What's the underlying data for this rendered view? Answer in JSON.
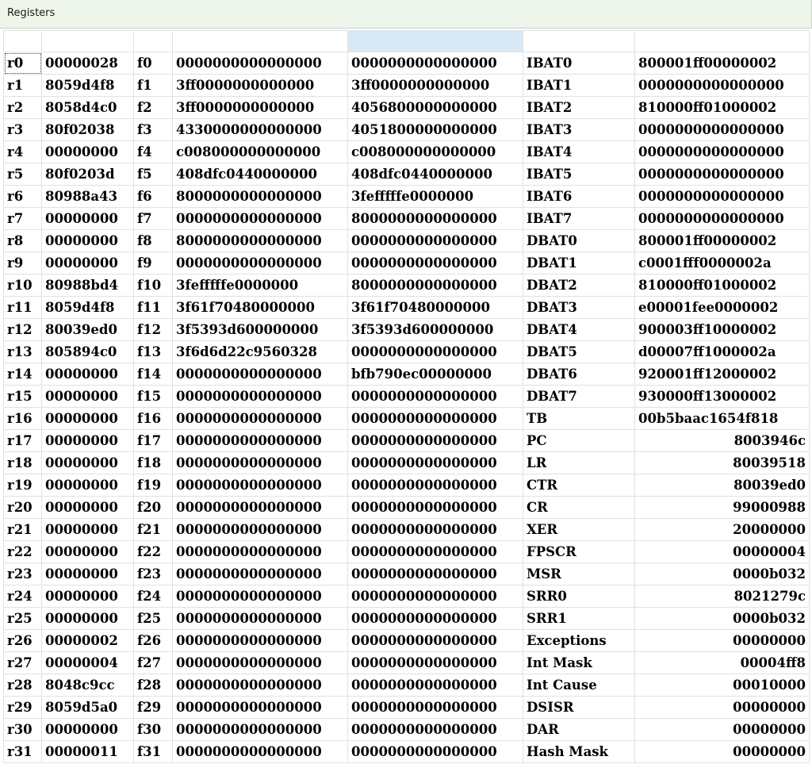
{
  "window": {
    "title": "Registers"
  },
  "gpr": [
    {
      "name": "r0",
      "value": "00000028"
    },
    {
      "name": "r1",
      "value": "8059d4f8"
    },
    {
      "name": "r2",
      "value": "8058d4c0"
    },
    {
      "name": "r3",
      "value": "80f02038"
    },
    {
      "name": "r4",
      "value": "00000000"
    },
    {
      "name": "r5",
      "value": "80f0203d"
    },
    {
      "name": "r6",
      "value": "80988a43"
    },
    {
      "name": "r7",
      "value": "00000000"
    },
    {
      "name": "r8",
      "value": "00000000"
    },
    {
      "name": "r9",
      "value": "00000000"
    },
    {
      "name": "r10",
      "value": "80988bd4"
    },
    {
      "name": "r11",
      "value": "8059d4f8"
    },
    {
      "name": "r12",
      "value": "80039ed0"
    },
    {
      "name": "r13",
      "value": "805894c0"
    },
    {
      "name": "r14",
      "value": "00000000"
    },
    {
      "name": "r15",
      "value": "00000000"
    },
    {
      "name": "r16",
      "value": "00000000"
    },
    {
      "name": "r17",
      "value": "00000000"
    },
    {
      "name": "r18",
      "value": "00000000"
    },
    {
      "name": "r19",
      "value": "00000000"
    },
    {
      "name": "r20",
      "value": "00000000"
    },
    {
      "name": "r21",
      "value": "00000000"
    },
    {
      "name": "r22",
      "value": "00000000"
    },
    {
      "name": "r23",
      "value": "00000000"
    },
    {
      "name": "r24",
      "value": "00000000"
    },
    {
      "name": "r25",
      "value": "00000000"
    },
    {
      "name": "r26",
      "value": "00000002"
    },
    {
      "name": "r27",
      "value": "00000004"
    },
    {
      "name": "r28",
      "value": "8048c9cc"
    },
    {
      "name": "r29",
      "value": "8059d5a0"
    },
    {
      "name": "r30",
      "value": "00000000"
    },
    {
      "name": "r31",
      "value": "00000011"
    }
  ],
  "fpr": [
    {
      "name": "f0",
      "ps0": "0000000000000000",
      "ps1": "0000000000000000"
    },
    {
      "name": "f1",
      "ps0": "3ff0000000000000",
      "ps1": "3ff0000000000000"
    },
    {
      "name": "f2",
      "ps0": "3ff0000000000000",
      "ps1": "4056800000000000"
    },
    {
      "name": "f3",
      "ps0": "4330000000000000",
      "ps1": "4051800000000000"
    },
    {
      "name": "f4",
      "ps0": "c008000000000000",
      "ps1": "c008000000000000"
    },
    {
      "name": "f5",
      "ps0": "408dfc0440000000",
      "ps1": "408dfc0440000000"
    },
    {
      "name": "f6",
      "ps0": "8000000000000000",
      "ps1": "3fefffffe0000000"
    },
    {
      "name": "f7",
      "ps0": "0000000000000000",
      "ps1": "8000000000000000"
    },
    {
      "name": "f8",
      "ps0": "8000000000000000",
      "ps1": "0000000000000000"
    },
    {
      "name": "f9",
      "ps0": "0000000000000000",
      "ps1": "0000000000000000"
    },
    {
      "name": "f10",
      "ps0": "3fefffffe0000000",
      "ps1": "8000000000000000"
    },
    {
      "name": "f11",
      "ps0": "3f61f70480000000",
      "ps1": "3f61f70480000000"
    },
    {
      "name": "f12",
      "ps0": "3f5393d600000000",
      "ps1": "3f5393d600000000"
    },
    {
      "name": "f13",
      "ps0": "3f6d6d22c9560328",
      "ps1": "0000000000000000"
    },
    {
      "name": "f14",
      "ps0": "0000000000000000",
      "ps1": "bfb790ec00000000"
    },
    {
      "name": "f15",
      "ps0": "0000000000000000",
      "ps1": "0000000000000000"
    },
    {
      "name": "f16",
      "ps0": "0000000000000000",
      "ps1": "0000000000000000"
    },
    {
      "name": "f17",
      "ps0": "0000000000000000",
      "ps1": "0000000000000000"
    },
    {
      "name": "f18",
      "ps0": "0000000000000000",
      "ps1": "0000000000000000"
    },
    {
      "name": "f19",
      "ps0": "0000000000000000",
      "ps1": "0000000000000000"
    },
    {
      "name": "f20",
      "ps0": "0000000000000000",
      "ps1": "0000000000000000"
    },
    {
      "name": "f21",
      "ps0": "0000000000000000",
      "ps1": "0000000000000000"
    },
    {
      "name": "f22",
      "ps0": "0000000000000000",
      "ps1": "0000000000000000"
    },
    {
      "name": "f23",
      "ps0": "0000000000000000",
      "ps1": "0000000000000000"
    },
    {
      "name": "f24",
      "ps0": "0000000000000000",
      "ps1": "0000000000000000"
    },
    {
      "name": "f25",
      "ps0": "0000000000000000",
      "ps1": "0000000000000000"
    },
    {
      "name": "f26",
      "ps0": "0000000000000000",
      "ps1": "0000000000000000"
    },
    {
      "name": "f27",
      "ps0": "0000000000000000",
      "ps1": "0000000000000000"
    },
    {
      "name": "f28",
      "ps0": "0000000000000000",
      "ps1": "0000000000000000"
    },
    {
      "name": "f29",
      "ps0": "0000000000000000",
      "ps1": "0000000000000000"
    },
    {
      "name": "f30",
      "ps0": "0000000000000000",
      "ps1": "0000000000000000"
    },
    {
      "name": "f31",
      "ps0": "0000000000000000",
      "ps1": "0000000000000000"
    }
  ],
  "spr": [
    {
      "name": "IBAT0",
      "value": "800001ff00000002"
    },
    {
      "name": "IBAT1",
      "value": "0000000000000000"
    },
    {
      "name": "IBAT2",
      "value": "810000ff01000002"
    },
    {
      "name": "IBAT3",
      "value": "0000000000000000"
    },
    {
      "name": "IBAT4",
      "value": "0000000000000000"
    },
    {
      "name": "IBAT5",
      "value": "0000000000000000"
    },
    {
      "name": "IBAT6",
      "value": "0000000000000000"
    },
    {
      "name": "IBAT7",
      "value": "0000000000000000"
    },
    {
      "name": "DBAT0",
      "value": "800001ff00000002"
    },
    {
      "name": "DBAT1",
      "value": "c0001fff0000002a"
    },
    {
      "name": "DBAT2",
      "value": "810000ff01000002"
    },
    {
      "name": "DBAT3",
      "value": "e00001fee0000002"
    },
    {
      "name": "DBAT4",
      "value": "900003ff10000002"
    },
    {
      "name": "DBAT5",
      "value": "d00007ff1000002a"
    },
    {
      "name": "DBAT6",
      "value": "920001ff12000002"
    },
    {
      "name": "DBAT7",
      "value": "930000ff13000002"
    },
    {
      "name": "TB",
      "value": "00b5baac1654f818"
    },
    {
      "name": "PC",
      "value": "8003946c"
    },
    {
      "name": "LR",
      "value": "80039518"
    },
    {
      "name": "CTR",
      "value": "80039ed0"
    },
    {
      "name": "CR",
      "value": "99000988"
    },
    {
      "name": "XER",
      "value": "20000000"
    },
    {
      "name": "FPSCR",
      "value": "00000004"
    },
    {
      "name": "MSR",
      "value": "0000b032"
    },
    {
      "name": "SRR0",
      "value": "8021279c"
    },
    {
      "name": "SRR1",
      "value": "0000b032"
    },
    {
      "name": "Exceptions",
      "value": "00000000"
    },
    {
      "name": "Int Mask",
      "value": "00004ff8"
    },
    {
      "name": "Int Cause",
      "value": "00010000"
    },
    {
      "name": "DSISR",
      "value": "00000000"
    },
    {
      "name": "DAR",
      "value": "00000000"
    },
    {
      "name": "Hash Mask",
      "value": "00000000"
    }
  ],
  "colors": {
    "selection": "#d9e8f6",
    "title_bg": "#eef6ec",
    "grid_line": "#e1e1e1"
  }
}
